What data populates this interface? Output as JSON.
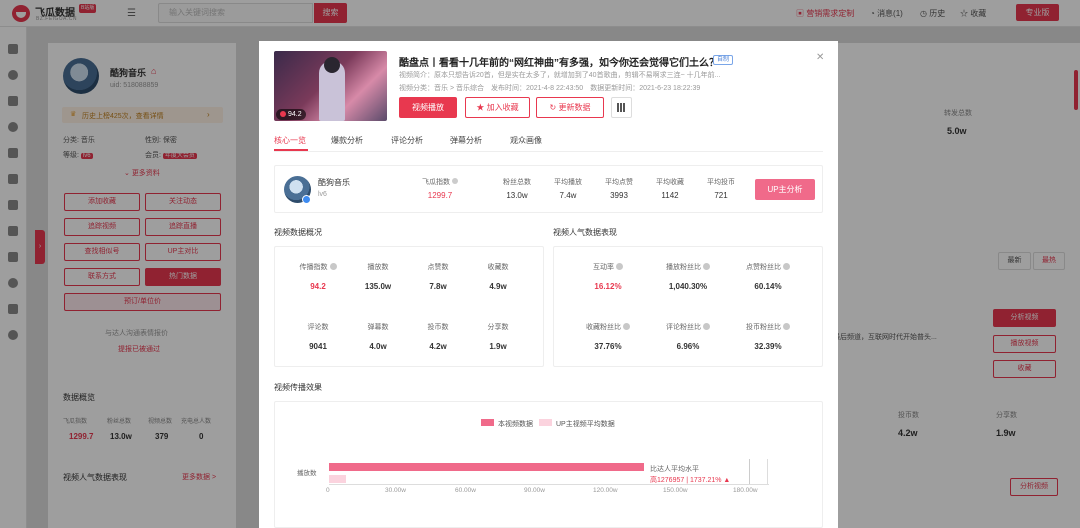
{
  "app": {
    "logo_text": "飞瓜数据",
    "logo_badge": "B站版",
    "logo_sub": "BZ.FEIGUA.CN",
    "search_placeholder": "输入关键词搜索",
    "search_btn": "搜索"
  },
  "topbar": {
    "links": [
      "营销需求定制",
      "消息(1)",
      "历史",
      "收藏"
    ],
    "pro": "专业版"
  },
  "bg_left": {
    "name": "酷狗音乐",
    "uid": "uid: 518088859",
    "banner": "历史上榜425次，查看详情",
    "category_label": "分类:",
    "category": "音乐",
    "gender_label": "性别:",
    "gender": "保密",
    "level_label": "等级:",
    "level": "lv6",
    "member_label": "会员:",
    "member": "年度大会员",
    "more": "更多资料",
    "buttons": [
      "添加收藏",
      "关注动态",
      "追踪视频",
      "追踪直播",
      "查找相似号",
      "UP主对比",
      "联系方式",
      "热门数据",
      "预订/单位价"
    ],
    "contact_title": "与达人沟通表情报价",
    "contact_link": "提报已被通过",
    "overview_title": "数据概览",
    "overview_labels": [
      "飞瓜指数",
      "粉丝总数",
      "视频总数",
      "充电总人数"
    ],
    "overview_values": [
      "1299.7",
      "13.0w",
      "379",
      "0"
    ],
    "perf_title": "视频人气数据表现",
    "perf_more": "更多数据 >"
  },
  "bg_right": {
    "top_label": "转发总数",
    "top_value": "5.0w",
    "btn_latest": "最新",
    "btn_hot": "最热",
    "desc": "最后频道，互联网时代开始普头...",
    "btns": [
      "分析视频",
      "播放视频",
      "收藏"
    ],
    "col1_label": "投币数",
    "col1_value": "4.2w",
    "col2_label": "分享数",
    "col2_value": "1.9w",
    "bottom_btn": "分析视频"
  },
  "modal": {
    "title": "酷盘点丨看看十几年前的“网红神曲”有多强，如今你还会觉得它们土么？",
    "badge": "自制",
    "meta1": "视频简介：原本只想告诉20首，但是实在太多了，就增加到了40首歌曲，剪辑不易啊求三连~ 十几年前...",
    "meta2": "视频分类：音乐 > 音乐综合　发布时间：2021-4-8 22:43:50　数据更新时间：2021-6-23 18:22:39",
    "score": "94.2",
    "buttons": {
      "play": "视频播放",
      "fav": "加入收藏",
      "refresh": "更新数据"
    },
    "tabs": [
      "核心一览",
      "爆款分析",
      "评论分析",
      "弹幕分析",
      "观众画像"
    ],
    "up": {
      "name": "酷狗音乐",
      "level": "lv6",
      "index_label": "飞瓜指数",
      "index_value": "1299.7",
      "stats": [
        {
          "label": "粉丝总数",
          "value": "13.0w"
        },
        {
          "label": "平均播放",
          "value": "7.4w"
        },
        {
          "label": "平均点赞",
          "value": "3993"
        },
        {
          "label": "平均收藏",
          "value": "1142"
        },
        {
          "label": "平均投币",
          "value": "721"
        }
      ],
      "analysis_btn": "UP主分析"
    },
    "overview": {
      "title": "视频数据概况",
      "row1": [
        {
          "label": "传播指数",
          "value": "94.2",
          "red": true,
          "q": true
        },
        {
          "label": "播放数",
          "value": "135.0w"
        },
        {
          "label": "点赞数",
          "value": "7.8w"
        },
        {
          "label": "收藏数",
          "value": "4.9w"
        }
      ],
      "row2": [
        {
          "label": "评论数",
          "value": "9041"
        },
        {
          "label": "弹幕数",
          "value": "4.0w"
        },
        {
          "label": "投币数",
          "value": "4.2w"
        },
        {
          "label": "分享数",
          "value": "1.9w"
        }
      ]
    },
    "popularity": {
      "title": "视频人气数据表现",
      "row1": [
        {
          "label": "互动率",
          "value": "16.12%",
          "red": true,
          "q": true
        },
        {
          "label": "播放粉丝比",
          "value": "1,040.30%",
          "q": true
        },
        {
          "label": "点赞粉丝比",
          "value": "60.14%",
          "q": true
        }
      ],
      "row2": [
        {
          "label": "收藏粉丝比",
          "value": "37.76%",
          "q": true
        },
        {
          "label": "评论粉丝比",
          "value": "6.96%",
          "q": true
        },
        {
          "label": "投币粉丝比",
          "value": "32.39%",
          "q": true
        }
      ]
    },
    "spread": {
      "title": "视频传播效果",
      "legend_a": "本视频数据",
      "legend_b": "UP主视频平均数据",
      "ylabel": "播放数",
      "compare_label": "比达人平均水平",
      "compare_value": "高1276957 | 1737.21% ▲"
    }
  },
  "chart_data": {
    "type": "bar",
    "orientation": "horizontal",
    "categories": [
      "播放数"
    ],
    "series": [
      {
        "name": "本视频数据",
        "values": [
          1350000
        ]
      },
      {
        "name": "UP主视频平均数据",
        "values": [
          74000
        ]
      }
    ],
    "xlim": [
      0,
      1800000
    ],
    "xticks": [
      "0",
      "30.00w",
      "60.00w",
      "90.00w",
      "120.00w",
      "150.00w",
      "180.00w"
    ],
    "colors": {
      "a": "#f06a8a",
      "b": "#fbd3de"
    }
  }
}
